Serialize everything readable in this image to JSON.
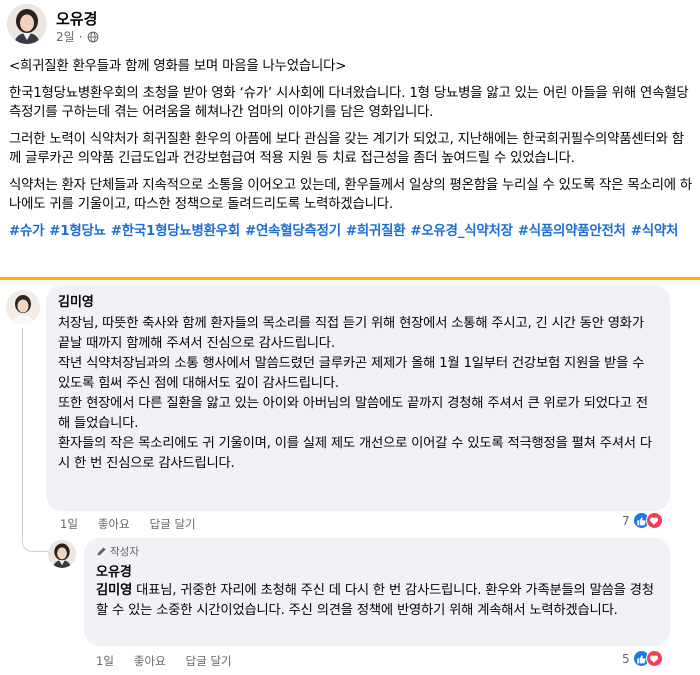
{
  "post": {
    "author": "오유경",
    "time": "2일",
    "paragraphs": [
      "<희귀질환 환우들과 함께 영화를 보며 마음을 나누었습니다>",
      "한국1형당뇨병환우회의 초청을 받아 영화 ‘슈가’ 시사회에 다녀왔습니다. 1형 당뇨병을 앓고 있는 어린 아들을 위해 연속혈당측정기를 구하는데 겪는 어려움을 헤쳐나간 엄마의 이야기를 담은 영화입니다.",
      "그러한 노력이 식약처가 희귀질환 환우의 아픔에 보다 관심을 갖는 계기가 되었고, 지난해에는 한국희귀필수의약품센터와 함께 글루카곤 의약품 긴급도입과 건강보험급여 적용 지원 등 치료 접근성을 좀더 높여드릴 수 있었습니다.",
      "식약처는 환자 단체들과 지속적으로 소통을 이어오고 있는데, 환우들께서 일상의 평온함을 누리실 수 있도록 작은 목소리에 하나에도 귀를 기울이고, 따스한 정책으로 돌려드리도록 노력하겠습니다."
    ],
    "hashtags": [
      "#슈가",
      "#1형당뇨",
      "#한국1형당뇨병환우회",
      "#연속혈당측정기",
      "#희귀질환",
      "#오유경_식약처장",
      "#식품의약품안전처",
      "#식약처"
    ]
  },
  "comment1": {
    "author": "김미영",
    "lines": [
      "처장님, 따뜻한 축사와 함께 환자들의 목소리를 직접 듣기 위해 현장에서 소통해 주시고, 긴 시간 동안 영화가 끝날 때까지 함께해 주셔서 진심으로 감사드립니다.",
      "작년 식약처장님과의 소통 행사에서 말씀드렸던 글루카곤 제제가 올해 1월 1일부터 건강보험 지원을 받을 수 있도록 힘써 주신 점에 대해서도 깊이 감사드립니다.",
      "또한 현장에서 다른 질환을 앓고 있는 아이와 아버님의 말씀에도 끝까지 경청해 주셔서 큰 위로가 되었다고 전해 들었습니다.",
      "환자들의 작은 목소리에도 귀 기울이며, 이를 실제 제도 개선으로 이어갈 수 있도록 적극행정을 펼쳐 주셔서 다시 한 번 진심으로 감사드립니다."
    ],
    "time": "1일",
    "like_label": "좋아요",
    "reply_label": "답글 달기",
    "reaction_count": "7"
  },
  "reply1": {
    "badge": "작성자",
    "author": "오유경",
    "mention": "김미영",
    "text": " 대표님, 귀중한 자리에 초청해 주신 데 다시 한 번 감사드립니다. 환우와 가족분들의 말씀을 경청할 수 있는 소중한 시간이었습니다. 주신 의견을 정책에 반영하기 위해 계속해서 노력하겠습니다.",
    "time": "1일",
    "like_label": "좋아요",
    "reply_label": "답글 달기",
    "reaction_count": "5"
  },
  "colors": {
    "hashtag": "#1a6ed8",
    "divider": "#f7b500",
    "bubble": "#f0f2f5",
    "like": "#1877f2",
    "love": "#f33e58"
  }
}
